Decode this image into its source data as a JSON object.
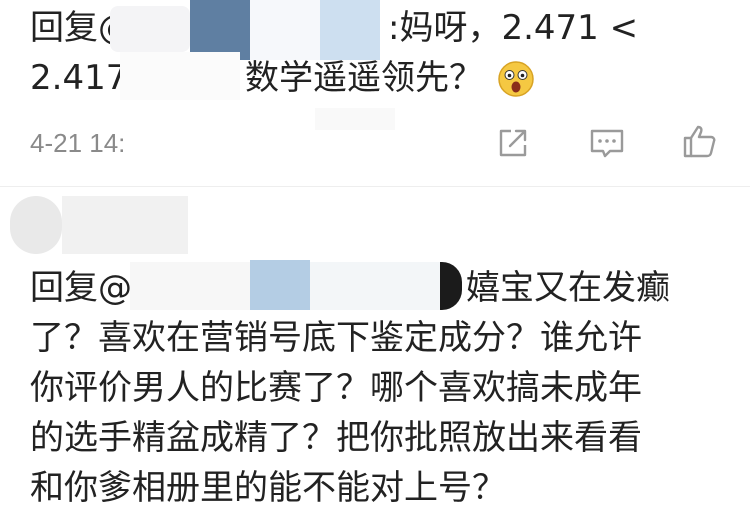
{
  "comment1": {
    "reply_prefix": "回复@",
    "line1_tail": ":妈呀，2.471 <",
    "line2_num": "2.417",
    "line2_tail": "数学遥遥领先？",
    "emoji": "😲",
    "time": "4-21 14:"
  },
  "actions": {
    "share_icon": "share-icon",
    "comment_icon": "comment-icon",
    "like_icon": "like-icon"
  },
  "comment2": {
    "reply_prefix": "回复@",
    "line1_tail": "嬉宝又在发癫",
    "lines": [
      "了？喜欢在营销号底下鉴定成分？谁允许",
      "你评价男人的比赛了？哪个喜欢搞未成年",
      "的选手精盆成精了？把你批照放出来看看",
      "和你爹相册里的能不能对上号？"
    ]
  },
  "colors": {
    "text": "#222222",
    "meta": "#8a8a8a",
    "icon": "#9a9a9a",
    "divider": "#eeeeee"
  }
}
